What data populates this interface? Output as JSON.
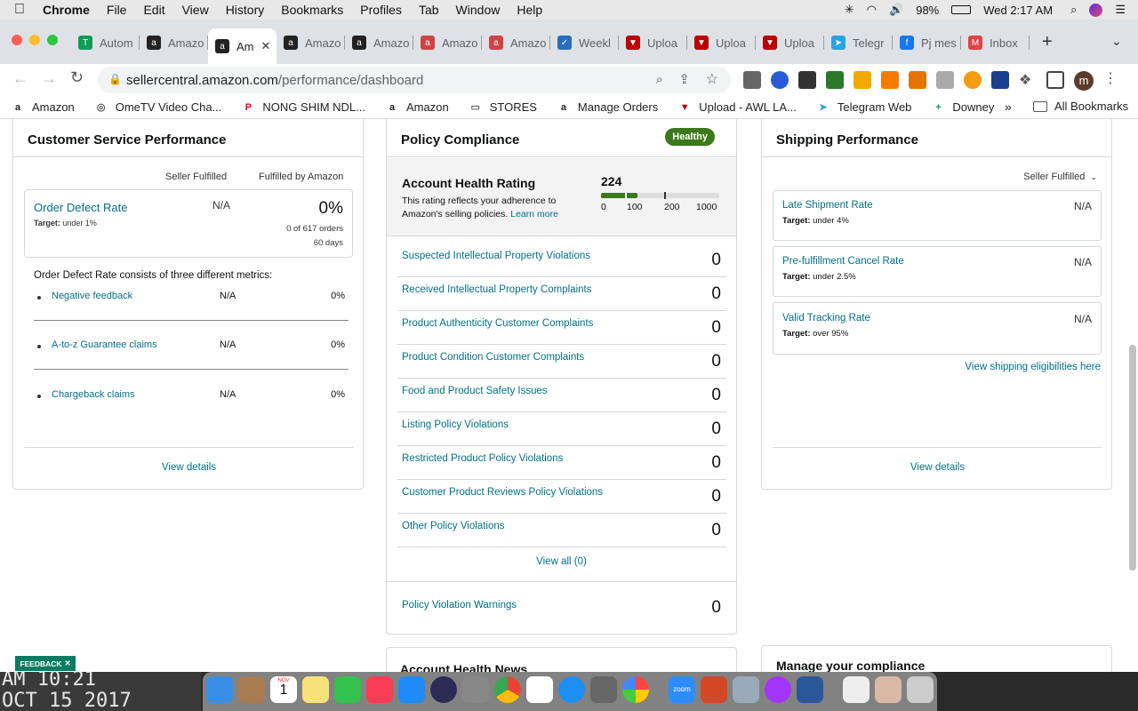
{
  "menubar": {
    "app": "Chrome",
    "items": [
      "File",
      "Edit",
      "View",
      "History",
      "Bookmarks",
      "Profiles",
      "Tab",
      "Window",
      "Help"
    ],
    "battery": "98%",
    "clock": "Wed 2:17 AM"
  },
  "tabs": [
    {
      "label": "Autom",
      "icon_color": "#0f9d58",
      "icon": "T"
    },
    {
      "label": "Amazo",
      "icon_color": "#222",
      "icon": "a"
    },
    {
      "label": "Am",
      "icon_color": "#222",
      "icon": "a",
      "active": true
    },
    {
      "label": "Amazo",
      "icon_color": "#222",
      "icon": "a"
    },
    {
      "label": "Amazo",
      "icon_color": "#222",
      "icon": "a"
    },
    {
      "label": "Amazo",
      "icon_color": "#c44",
      "icon": "a"
    },
    {
      "label": "Amazo",
      "icon_color": "#c44",
      "icon": "a"
    },
    {
      "label": "Weekl",
      "icon_color": "#2a6ebb",
      "icon": "✓"
    },
    {
      "label": "Uploa",
      "icon_color": "#b00",
      "icon": "▼"
    },
    {
      "label": "Uploa",
      "icon_color": "#b00",
      "icon": "▼"
    },
    {
      "label": "Uploa",
      "icon_color": "#b00",
      "icon": "▼"
    },
    {
      "label": "Telegr",
      "icon_color": "#2aa3df",
      "icon": "➤"
    },
    {
      "label": "Pj mes",
      "icon_color": "#1877f2",
      "icon": "f"
    },
    {
      "label": "Inbox",
      "icon_color": "#d44",
      "icon": "M"
    }
  ],
  "url": {
    "host": "sellercentral.amazon.com",
    "path": "/performance/dashboard"
  },
  "bookmarks": [
    {
      "label": "Amazon",
      "icon": "a",
      "color": "#222"
    },
    {
      "label": "OmeTV Video Cha...",
      "icon": "◎",
      "color": "#555"
    },
    {
      "label": "NONG SHIM NDL...",
      "icon": "P",
      "color": "#e60023"
    },
    {
      "label": "Amazon",
      "icon": "a",
      "color": "#222"
    },
    {
      "label": "STORES",
      "icon": "▭",
      "color": "#666"
    },
    {
      "label": "Manage Orders",
      "icon": "a",
      "color": "#222"
    },
    {
      "label": "Upload - AWL LA...",
      "icon": "▼",
      "color": "#b00"
    },
    {
      "label": "Telegram Web",
      "icon": "➤",
      "color": "#2aa3df"
    },
    {
      "label": "Downey",
      "icon": "+",
      "color": "#0f9d58"
    }
  ],
  "all_bookmarks": "All Bookmarks",
  "customer_service": {
    "title": "Customer Service Performance",
    "col1": "Seller Fulfilled",
    "col2": "Fulfilled by Amazon",
    "odr_label": "Order Defect Rate",
    "odr_target": "under 1%",
    "target_prefix": "Target:",
    "odr_seller": "N/A",
    "odr_fba": "0%",
    "odr_orders": "0 of 617 orders",
    "odr_days": "60 days",
    "intro": "Order Defect Rate consists of three different metrics:",
    "metrics": [
      {
        "label": "Negative feedback",
        "seller": "N/A",
        "fba": "0%"
      },
      {
        "label": "A-to-z Guarantee claims",
        "seller": "N/A",
        "fba": "0%"
      },
      {
        "label": "Chargeback claims",
        "seller": "N/A",
        "fba": "0%"
      }
    ],
    "view_details": "View details"
  },
  "policy": {
    "title": "Policy Compliance",
    "badge": "Healthy",
    "ahr_title": "Account Health Rating",
    "ahr_desc": "This rating reflects your adherence to Amazon's selling policies.",
    "learn_more": "Learn more",
    "ahr_value": "224",
    "ahr_fraction": 0.224,
    "scale": [
      "0",
      "100",
      "200",
      "1000"
    ],
    "rows": [
      {
        "label": "Suspected Intellectual Property Violations",
        "value": "0"
      },
      {
        "label": "Received Intellectual Property Complaints",
        "value": "0"
      },
      {
        "label": "Product Authenticity Customer Complaints",
        "value": "0"
      },
      {
        "label": "Product Condition Customer Complaints",
        "value": "0"
      },
      {
        "label": "Food and Product Safety Issues",
        "value": "0"
      },
      {
        "label": "Listing Policy Violations",
        "value": "0"
      },
      {
        "label": "Restricted Product Policy Violations",
        "value": "0"
      },
      {
        "label": "Customer Product Reviews Policy Violations",
        "value": "0"
      },
      {
        "label": "Other Policy Violations",
        "value": "0"
      }
    ],
    "view_all": "View all (0)",
    "warnings_label": "Policy Violation Warnings",
    "warnings_value": "0"
  },
  "shipping": {
    "title": "Shipping Performance",
    "dropdown": "Seller Fulfilled",
    "target_prefix": "Target:",
    "metrics": [
      {
        "label": "Late Shipment Rate",
        "target": "under 4%",
        "value": "N/A"
      },
      {
        "label": "Pre-fulfillment Cancel Rate",
        "target": "under 2.5%",
        "value": "N/A"
      },
      {
        "label": "Valid Tracking Rate",
        "target": "over 95%",
        "value": "N/A"
      }
    ],
    "eligibilities": "View shipping eligibilities here",
    "view_details": "View details"
  },
  "bottom": {
    "news": "Account Health News",
    "manage": "Manage your compliance"
  },
  "feedback": "FEEDBACK",
  "wallpaper_text": [
    "AM 10:21",
    "OCT 15 2017"
  ],
  "dock_calendar": {
    "month": "NOV",
    "day": "1"
  },
  "dock_zoom": "zoom"
}
